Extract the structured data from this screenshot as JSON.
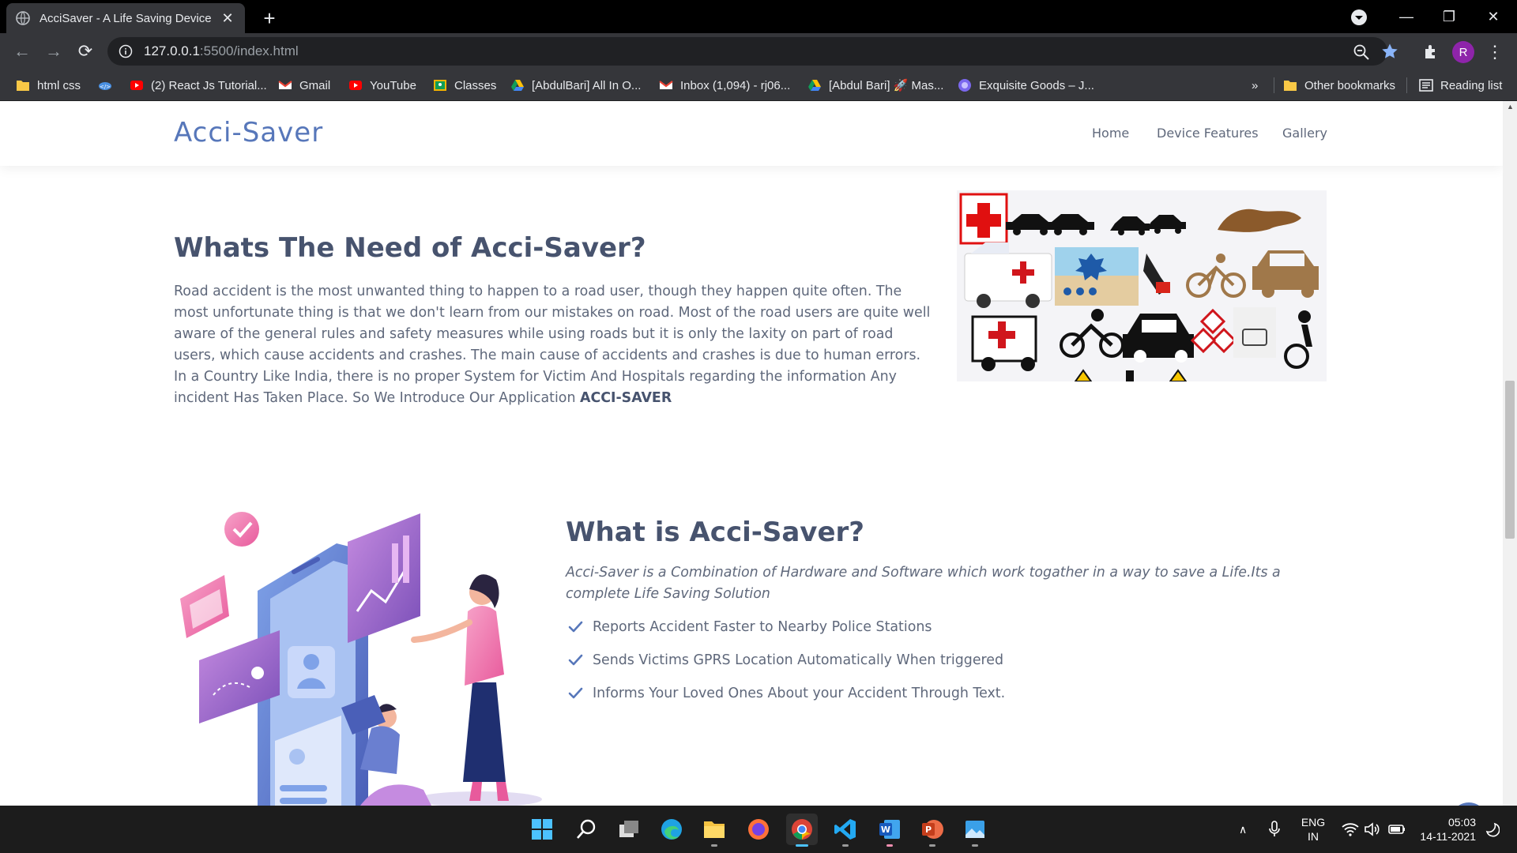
{
  "browser": {
    "tab_title": "AcciSaver - A Life Saving Device",
    "url_host": "127.0.0.1",
    "url_path": ":5500/index.html",
    "profile_initial": "R",
    "bookmarks": [
      {
        "label": "html css",
        "icon": "folder-icon"
      },
      {
        "label": "",
        "icon": "cloud-icon"
      },
      {
        "label": "(2) React Js Tutorial...",
        "icon": "youtube-icon"
      },
      {
        "label": "Gmail",
        "icon": "gmail-icon"
      },
      {
        "label": "YouTube",
        "icon": "youtube-icon"
      },
      {
        "label": "Classes",
        "icon": "classroom-icon"
      },
      {
        "label": "[AbdulBari] All In O...",
        "icon": "drive-icon"
      },
      {
        "label": "Inbox (1,094) - rj06...",
        "icon": "gmail-icon"
      },
      {
        "label": "[Abdul Bari] 🚀 Mas...",
        "icon": "drive-icon"
      },
      {
        "label": "Exquisite Goods – J...",
        "icon": "globe-icon"
      }
    ],
    "overflow_label": "»",
    "other_bookmarks": "Other bookmarks",
    "reading_list": "Reading list"
  },
  "site": {
    "logo": "Acci-Saver",
    "nav": [
      "Home",
      "Device Features",
      "Gallery"
    ]
  },
  "need": {
    "title": "Whats The Need of Acci-Saver?",
    "body": "Road accident is the most unwanted thing to happen to a road user, though they happen quite often. The most unfortunate thing is that we don't learn from our mistakes on road. Most of the road users are quite well aware of the general rules and safety measures while using roads but it is only the laxity on part of road users, which cause accidents and crashes. The main cause of accidents and crashes is due to human errors. In a Country Like India, there is no proper System for Victim And Hospitals regarding the information Any incident Has Taken Place. So We Introduce Our Application ",
    "body_strong": "ACCI-SAVER"
  },
  "what": {
    "title": "What is Acci-Saver?",
    "intro": "Acci-Saver is a Combination of Hardware and Software which work togather in a way to save a Life.Its a complete Life Saving Solution",
    "features": [
      "Reports Accident Faster to Nearby Police Stations",
      "Sends Victims GPRS Location Automatically When triggered",
      "Informs Your Loved Ones About your Accident Through Text."
    ]
  },
  "taskbar": {
    "lang_line1": "ENG",
    "lang_line2": "IN",
    "time": "05:03",
    "date": "14-11-2021"
  },
  "colors": {
    "accent": "#5777ba",
    "heading": "#47536e",
    "body_text": "#5f687b"
  }
}
